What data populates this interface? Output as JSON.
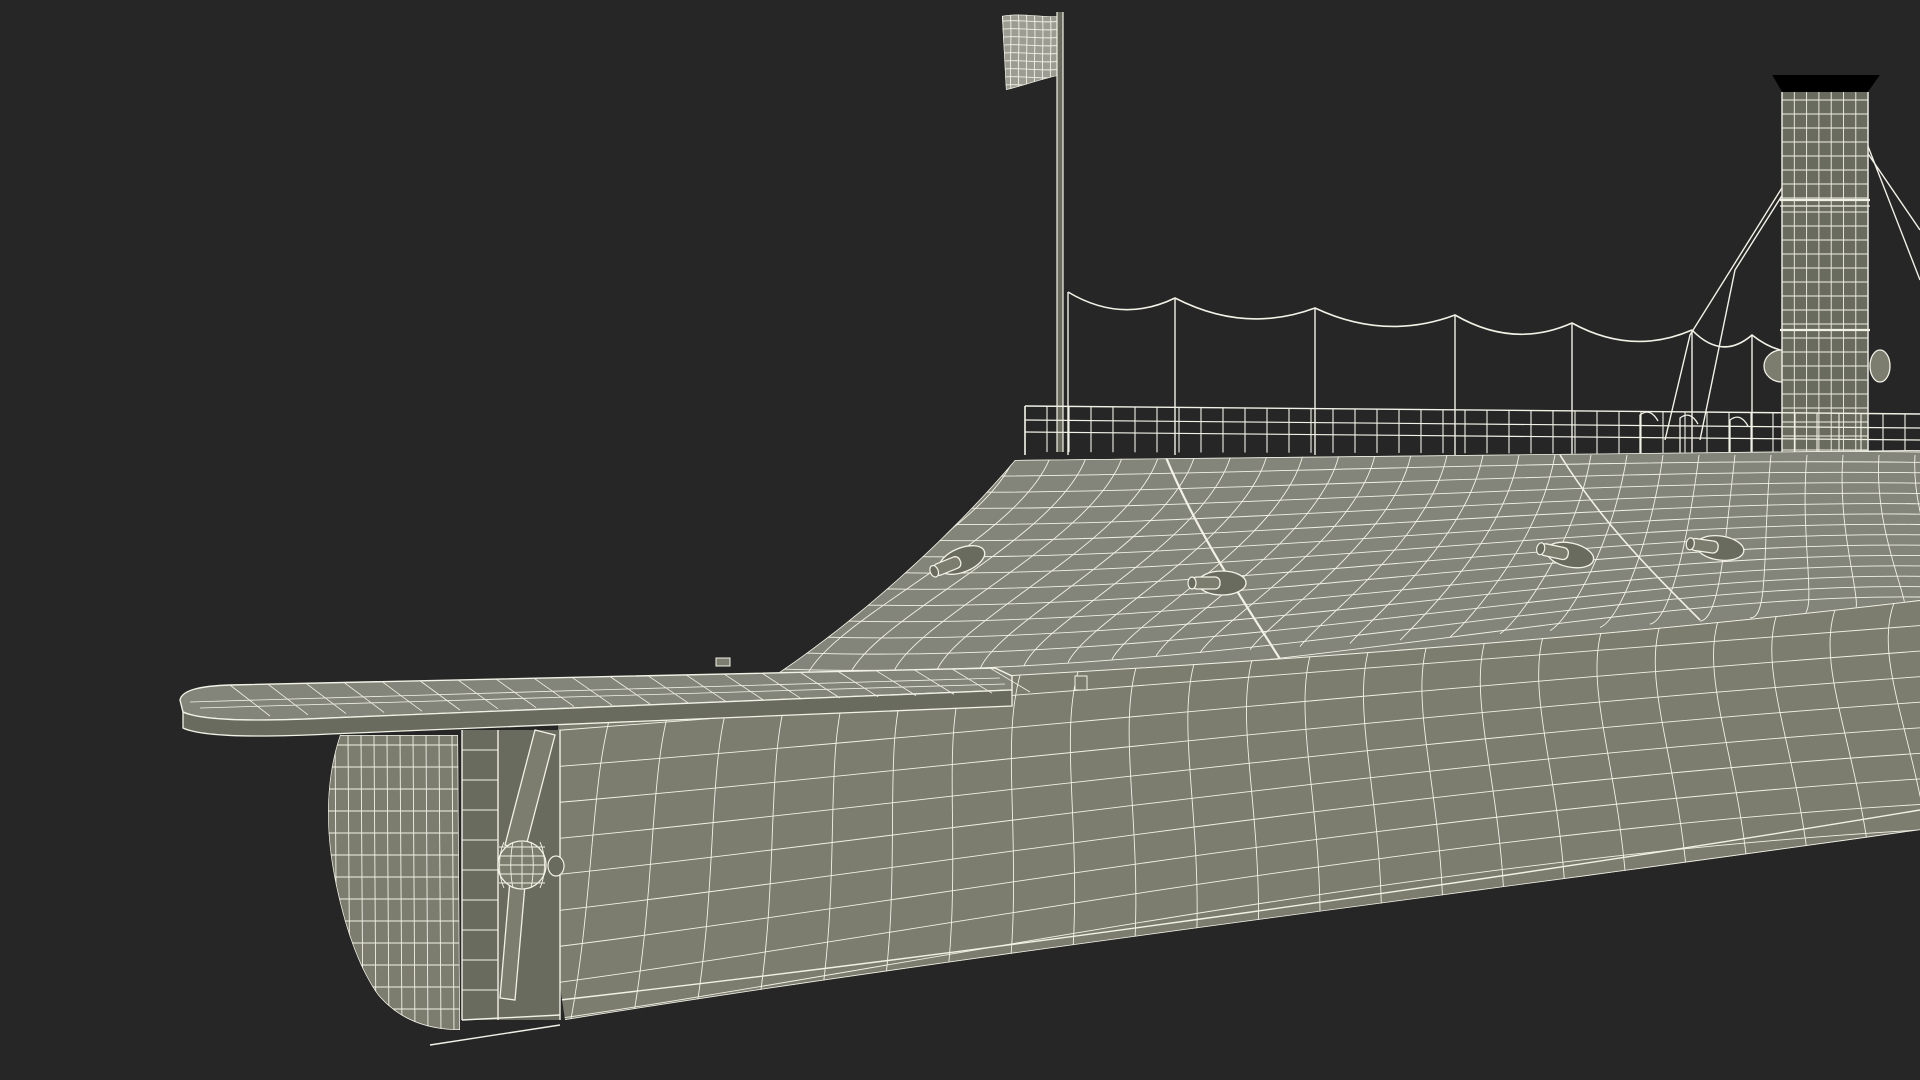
{
  "viewport": {
    "background": "#262626",
    "render_style": "wireframe-on-shaded"
  },
  "palette": {
    "wire": "#f2f1e6",
    "hull_surface": "#7c7d6f",
    "deck_surface": "#84857a",
    "shade_surface": "#6a6b5f",
    "flag_surface": "#9c9c92"
  },
  "model": {
    "subject": "ironclad-ship-stern",
    "parts": [
      "flag",
      "flagpole",
      "awning-rope",
      "railing",
      "smokestack",
      "casemate",
      "hull",
      "stern-deck",
      "rudder",
      "propeller",
      "gun-ports"
    ]
  }
}
